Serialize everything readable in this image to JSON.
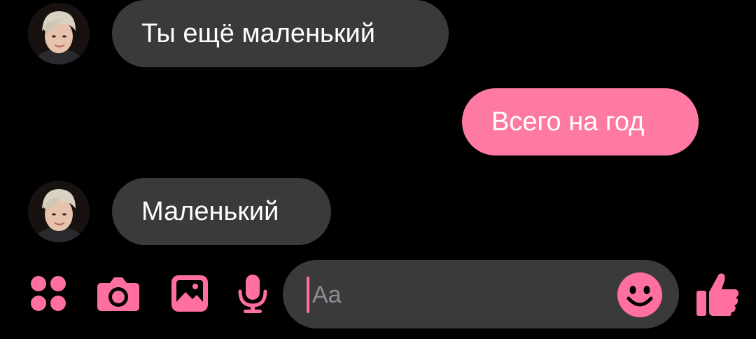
{
  "accent_color": "#ff6f9f",
  "incoming_bubble_color": "#3a393b",
  "outgoing_bubble_color": "#ff7aa3",
  "messages": [
    {
      "direction": "incoming",
      "text": "Ты ещё маленький",
      "show_avatar": true
    },
    {
      "direction": "outgoing",
      "text": "Всего на год",
      "show_avatar": false
    },
    {
      "direction": "incoming",
      "text": "Маленький",
      "show_avatar": true
    }
  ],
  "composer": {
    "placeholder": "Aa",
    "value": "",
    "icons": [
      "more-actions-icon",
      "camera-icon",
      "gallery-icon",
      "microphone-icon",
      "emoji-icon",
      "thumbs-up-icon"
    ]
  }
}
